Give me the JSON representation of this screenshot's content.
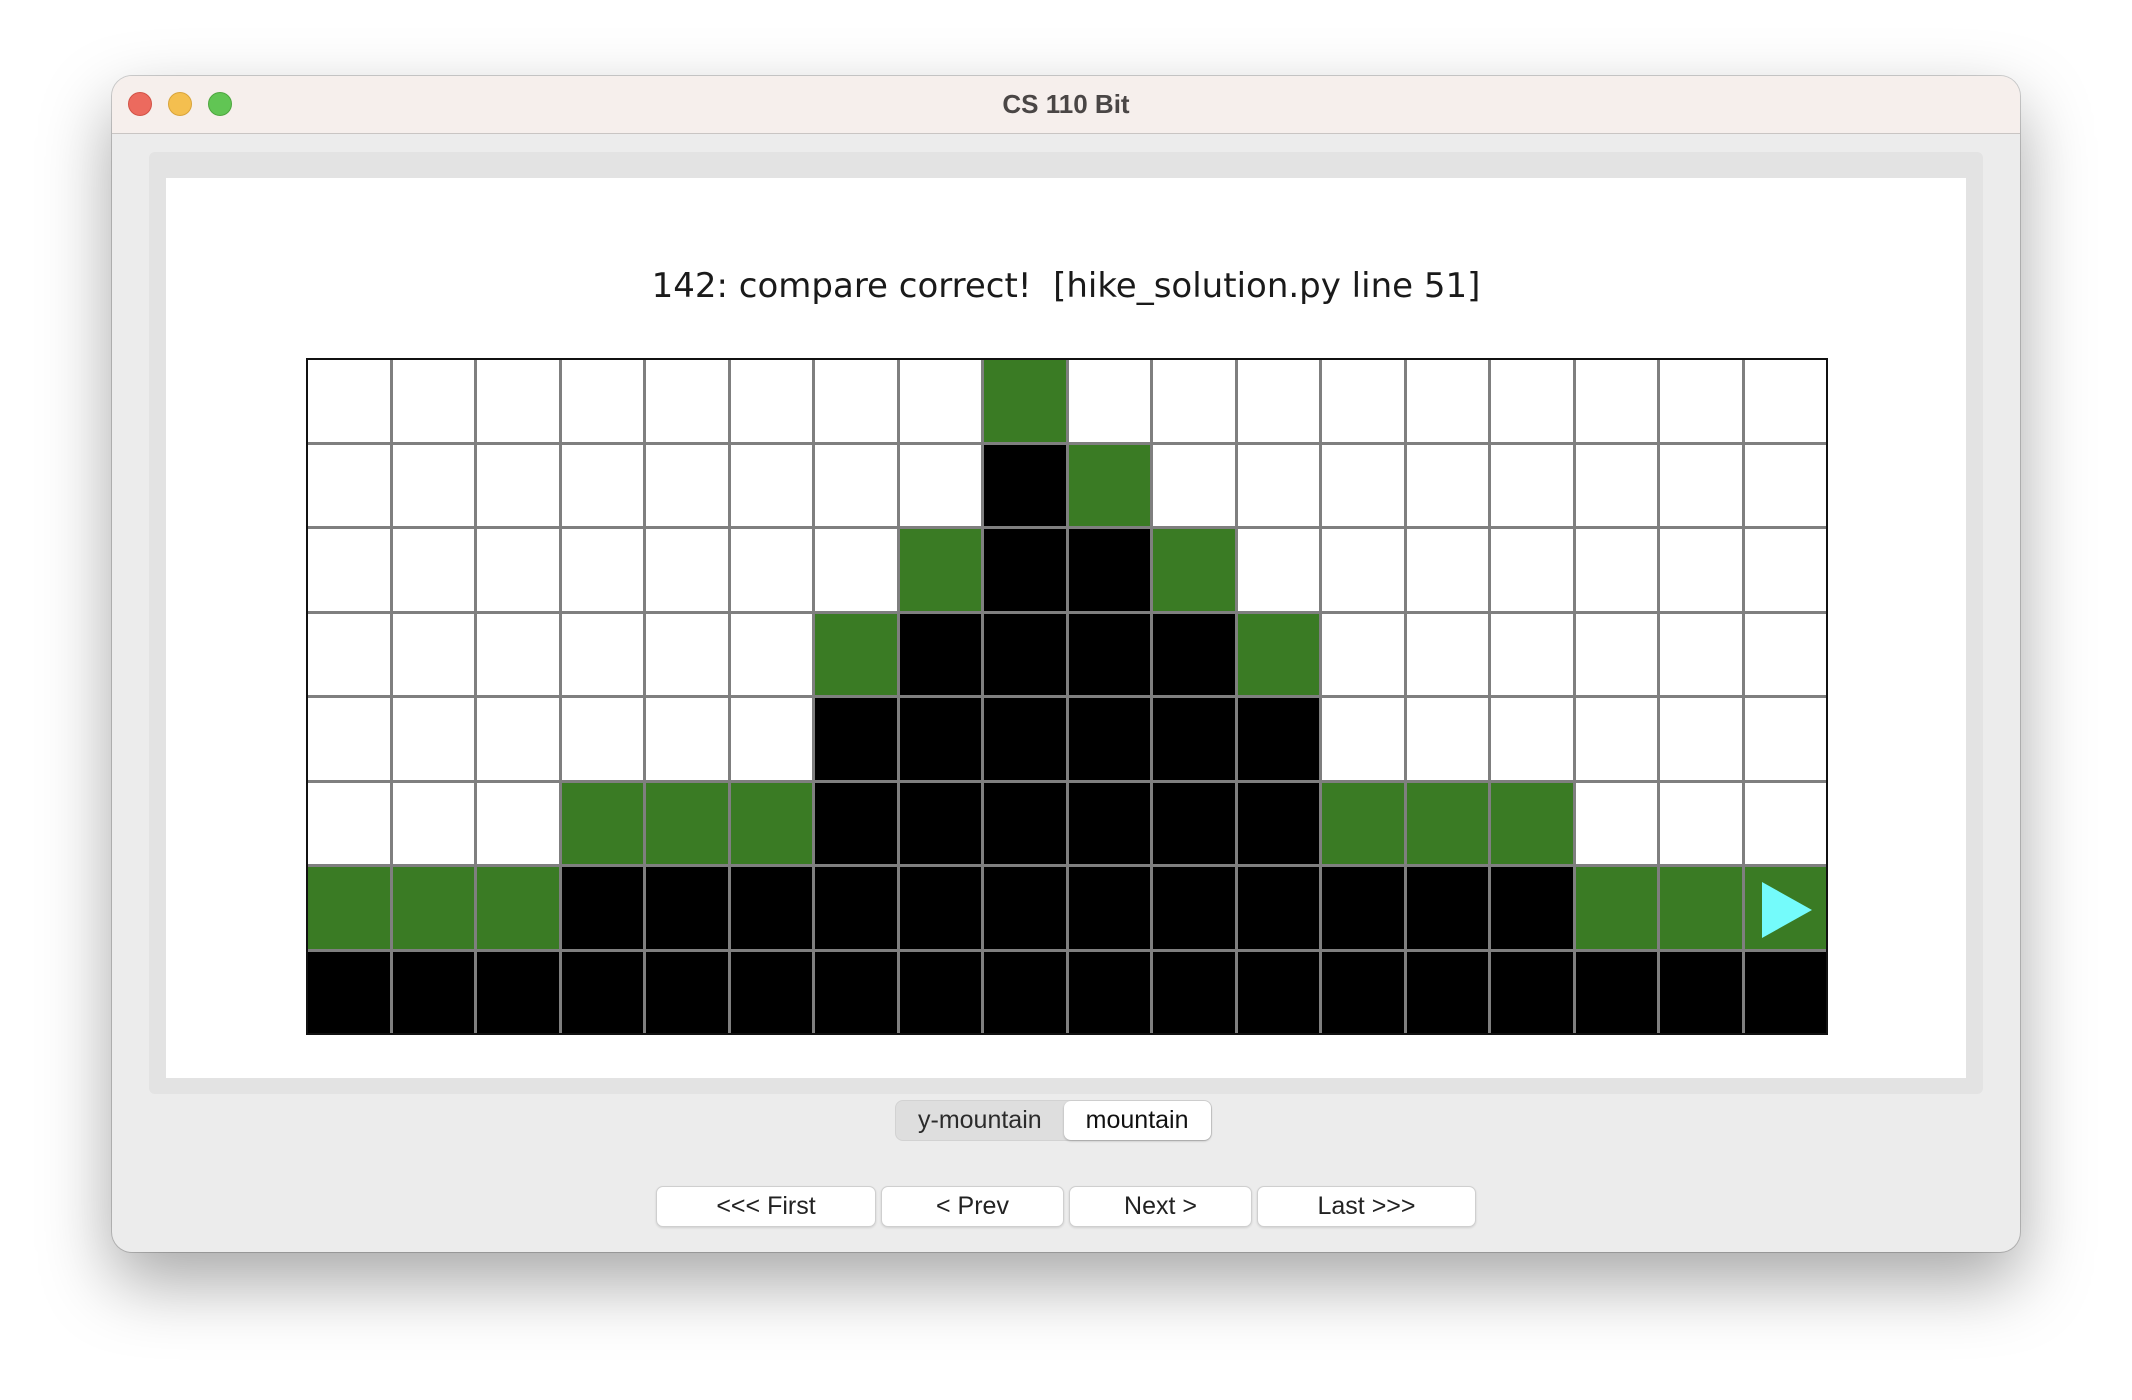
{
  "window": {
    "title": "CS 110 Bit",
    "controls": [
      "close",
      "minimize",
      "maximize"
    ]
  },
  "canvas": {
    "message": "142: compare correct!  [hike_solution.py line 51]",
    "grid": {
      "cols": 18,
      "rows": 8,
      "legend": {
        "W": "white",
        "K": "black",
        "G": "green"
      },
      "colors": {
        "white": "#ffffff",
        "black": "#000000",
        "green": "#3a7b24",
        "grid_line": "#7f7f7f",
        "bit_arrow": "#74fbfb"
      },
      "cells": [
        "WWWWWWWWGWWWWWWWWW",
        "WWWWWWWWKGWWWWWWWW",
        "WWWWWWWGKKGWWWWWWW",
        "WWWWWWGKKKKGWWWWWW",
        "WWWWWWKKKKKKWWWWWW",
        "WWWGGGKKKKKKGGGWWW",
        "GGGKKKKKKKKKKKKGGG",
        "KKKKKKKKKKKKKKKKKK"
      ],
      "bit": {
        "row": 6,
        "col": 17,
        "direction": "right",
        "icon": "play-triangle-icon"
      }
    }
  },
  "segmented": {
    "options": [
      {
        "label": "y-mountain",
        "selected": false
      },
      {
        "label": "mountain",
        "selected": true
      }
    ]
  },
  "nav": {
    "first": "<<< First",
    "prev": "< Prev",
    "next": "Next >",
    "last": "Last >>>"
  }
}
